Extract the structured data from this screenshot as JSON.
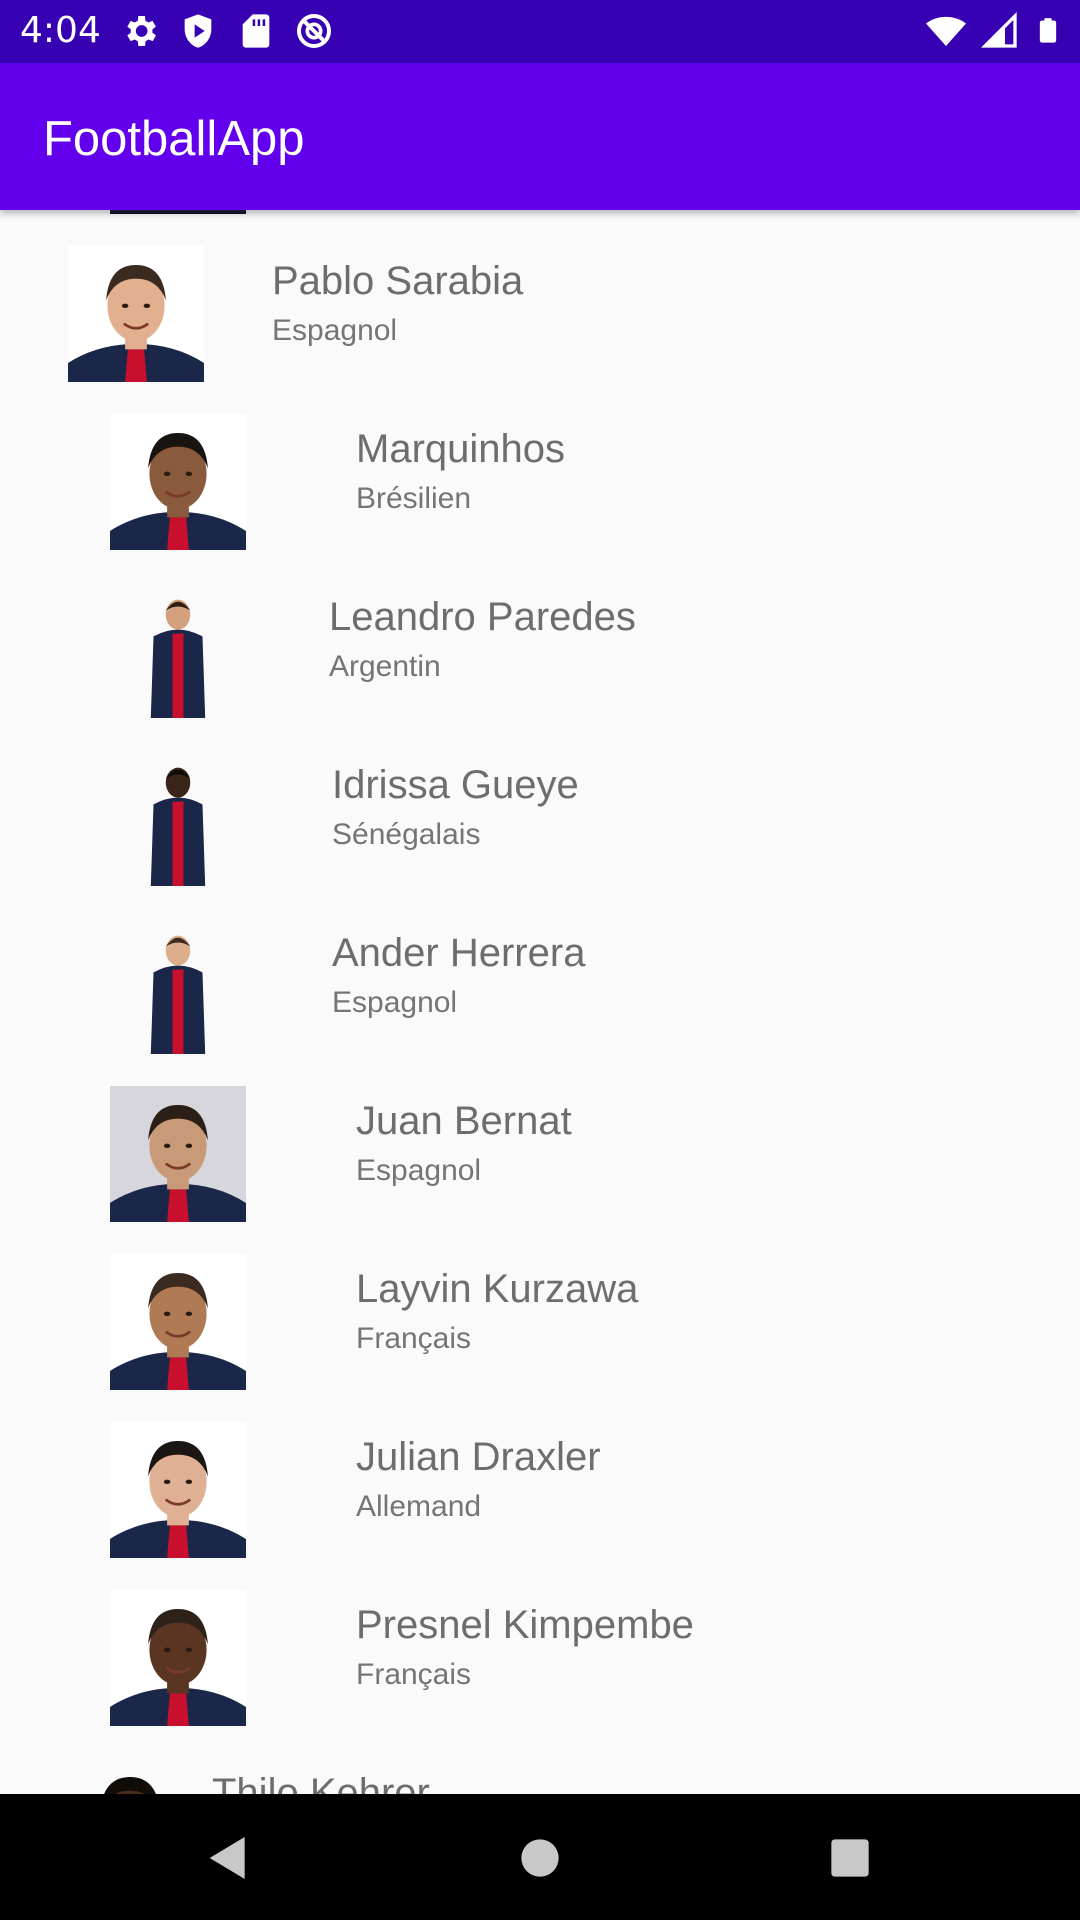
{
  "status_bar": {
    "time": "4:04",
    "left_icons": [
      "settings-icon",
      "play-protect-icon",
      "sd-card-icon",
      "do-not-disturb-icon"
    ],
    "right_icons": [
      "wifi-icon",
      "cellular-signal-icon",
      "battery-icon"
    ]
  },
  "app_bar": {
    "title": "FootballApp",
    "color": "#6200ee",
    "status_color": "#3700b3"
  },
  "players": [
    {
      "name": "Pablo Sarabia",
      "nationality": "Espagnol",
      "thumb_bg": "#ffffff",
      "skin": "#e2b08f",
      "hair": "#3a2a20"
    },
    {
      "name": "Marquinhos",
      "nationality": "Brésilien",
      "thumb_bg": "#ffffff",
      "skin": "#8a5a3c",
      "hair": "#1a1410"
    },
    {
      "name": "Leandro Paredes",
      "nationality": "Argentin",
      "thumb_bg": "#fafafa",
      "skin": "#d4a17e",
      "hair": "#2a1e16"
    },
    {
      "name": "Idrissa Gueye",
      "nationality": "Sénégalais",
      "thumb_bg": "#fafafa",
      "skin": "#3b2418",
      "hair": "#120c08"
    },
    {
      "name": "Ander Herrera",
      "nationality": "Espagnol",
      "thumb_bg": "#fafafa",
      "skin": "#dcae8c",
      "hair": "#3a2a20"
    },
    {
      "name": "Juan Bernat",
      "nationality": "Espagnol",
      "thumb_bg": "#d7d6dc",
      "skin": "#c99a78",
      "hair": "#2a1e16"
    },
    {
      "name": "Layvin Kurzawa",
      "nationality": "Français",
      "thumb_bg": "#ffffff",
      "skin": "#b07a55",
      "hair": "#3a2a20"
    },
    {
      "name": "Julian Draxler",
      "nationality": "Allemand",
      "thumb_bg": "#ffffff",
      "skin": "#e0b094",
      "hair": "#1c1612"
    },
    {
      "name": "Presnel Kimpembe",
      "nationality": "Français",
      "thumb_bg": "#ffffff",
      "skin": "#5a3522",
      "hair": "#2e2218"
    },
    {
      "name": "Thilo Kehrer",
      "nationality": "",
      "thumb_bg": "#fafafa",
      "skin": "#4a2c1c",
      "hair": "#120c08"
    }
  ],
  "nav_bar": {
    "back": "back-icon",
    "home": "home-icon",
    "recents": "recents-icon"
  }
}
